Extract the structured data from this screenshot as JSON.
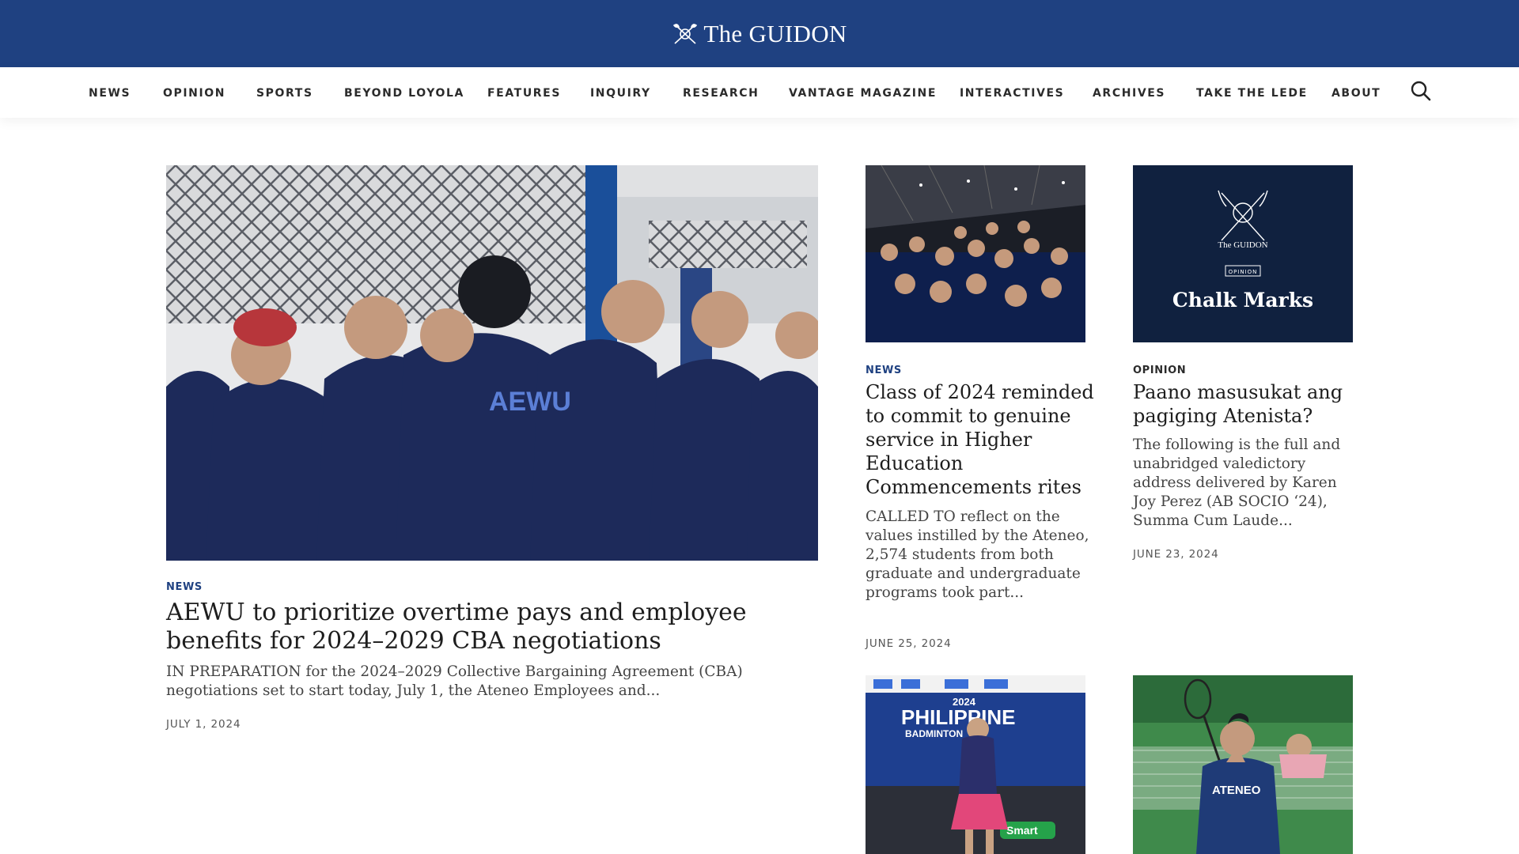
{
  "site": {
    "name": "The GUIDON"
  },
  "colors": {
    "brand_blue": "#1f4181",
    "kicker_news": "#1f4181",
    "kicker_opinion": "#2b2b2b",
    "opinion_card_bg": "#10213f"
  },
  "nav": {
    "items": [
      "NEWS",
      "OPINION",
      "SPORTS",
      "BEYOND LOYOLA",
      "FEATURES",
      "INQUIRY",
      "RESEARCH",
      "VANTAGE MAGAZINE",
      "INTERACTIVES",
      "ARCHIVES",
      "TAKE THE LEDE",
      "ABOUT"
    ],
    "search_icon": "search-icon"
  },
  "featured": {
    "category": "NEWS",
    "headline": "AEWU to prioritize overtime pays and employee benefits for 2024–2029 CBA negotiations",
    "excerpt": "IN PREPARATION for the 2024–2029 Collective Bargaining Agreement (CBA) negotiations set to start today, July 1, the Ateneo Employees and...",
    "date": "JULY 1, 2024",
    "image_text": "AEWU"
  },
  "card1": {
    "category": "NEWS",
    "headline": "Class of 2024 reminded to commit to genuine service in Higher Education Commencements rites",
    "excerpt": "CALLED TO reflect on the values instilled by the Ateneo, 2,574 students from both graduate and undergraduate programs took part...",
    "date": "JUNE 25, 2024"
  },
  "card2": {
    "category": "OPINION",
    "headline": "Paano masusukat ang pagiging Atenista?",
    "excerpt": "The following is the full and unabridged valedictory address delivered by Karen Joy Perez (AB SOCIO ‘24), Summa Cum Laude...",
    "date": "JUNE 23, 2024",
    "image": {
      "brand": "The GUIDON",
      "badge": "OPINION",
      "title": "Chalk Marks"
    }
  },
  "card3": {
    "image_text": [
      "2024",
      "PHILIPPINE",
      "BADMINTON",
      "Smart"
    ]
  },
  "card4": {
    "image_text": "ATENEO"
  }
}
